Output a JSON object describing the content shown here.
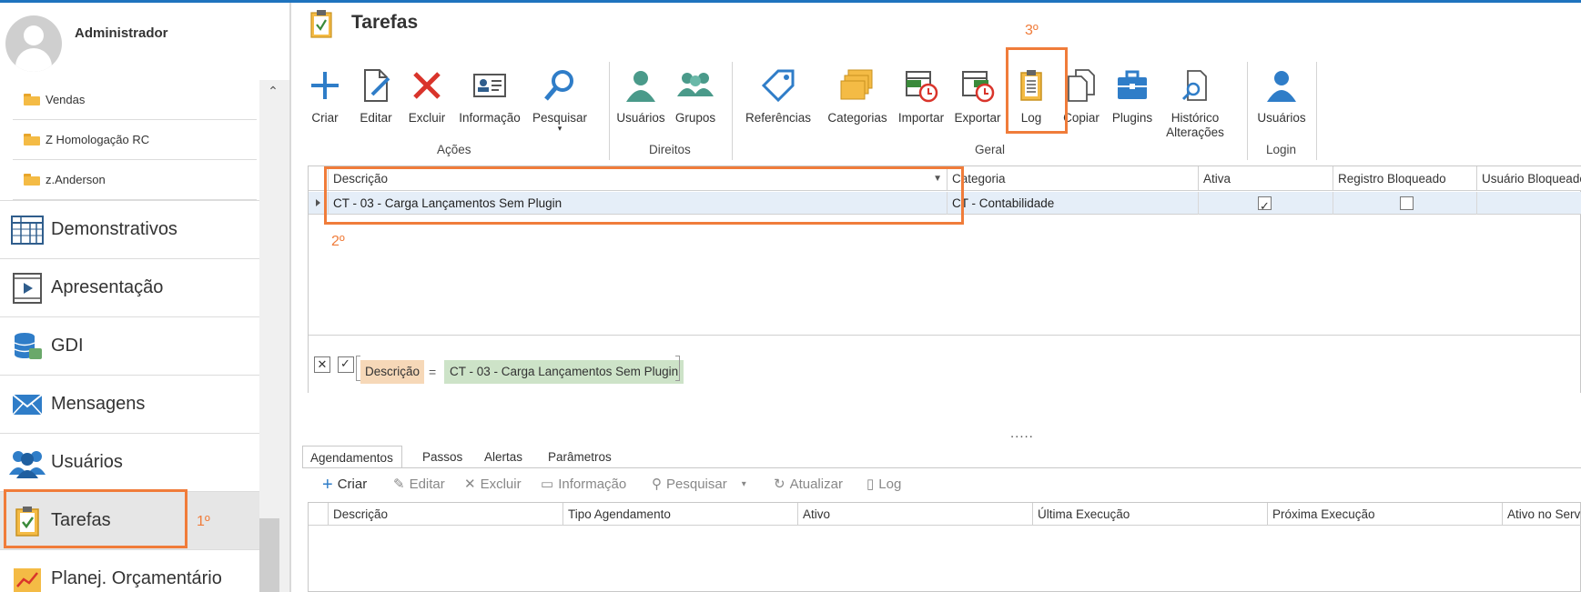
{
  "user": {
    "name": "Administrador"
  },
  "tree": {
    "items": [
      {
        "label": "Vendas"
      },
      {
        "label": "Z Homologação RC"
      },
      {
        "label": "z.Anderson"
      }
    ]
  },
  "nav": {
    "items": [
      {
        "label": "Demonstrativos",
        "icon": "table-chart-icon"
      },
      {
        "label": "Apresentação",
        "icon": "presentation-play-icon"
      },
      {
        "label": "GDI",
        "icon": "database-icon"
      },
      {
        "label": "Mensagens",
        "icon": "envelope-icon"
      },
      {
        "label": "Usuários",
        "icon": "users-icon"
      },
      {
        "label": "Tarefas",
        "icon": "clipboard-check-icon"
      },
      {
        "label": "Planej. Orçamentário",
        "icon": "trend-chart-icon"
      }
    ]
  },
  "page": {
    "title": "Tarefas"
  },
  "ribbon": {
    "acoes": {
      "label": "Ações",
      "buttons": [
        "Criar",
        "Editar",
        "Excluir",
        "Informação",
        "Pesquisar"
      ]
    },
    "direitos": {
      "label": "Direitos",
      "buttons": [
        "Usuários",
        "Grupos"
      ]
    },
    "geral": {
      "label": "Geral",
      "buttons": [
        "Referências",
        "Categorias",
        "Importar",
        "Exportar",
        "Log",
        "Copiar",
        "Plugins",
        "Histórico",
        "Alterações"
      ]
    },
    "login": {
      "label": "Login",
      "buttons": [
        "Usuários"
      ]
    }
  },
  "grid": {
    "columns": [
      "Descrição",
      "Categoria",
      "Ativa",
      "Registro Bloqueado",
      "Usuário Bloqueado"
    ],
    "rows": [
      {
        "descricao": "CT - 03 - Carga Lançamentos Sem Plugin",
        "categoria": "CT - Contabilidade",
        "ativa": true,
        "bloqueado": false
      }
    ]
  },
  "filter": {
    "field": "Descrição",
    "operator": "=",
    "value": "CT - 03 - Carga Lançamentos Sem Plugin"
  },
  "splitter": ".....",
  "tabs": [
    "Agendamentos",
    "Passos",
    "Alertas",
    "Parâmetros"
  ],
  "subtoolbar": [
    "Criar",
    "Editar",
    "Excluir",
    "Informação",
    "Pesquisar",
    "Atualizar",
    "Log"
  ],
  "grid2": {
    "columns": [
      "Descrição",
      "Tipo Agendamento",
      "Ativo",
      "Última Execução",
      "Próxima Execução",
      "Ativo no Servi"
    ]
  },
  "annotations": [
    "1º",
    "2º",
    "3º"
  ],
  "colors": {
    "accent": "#1e73be",
    "annotation": "#f07c3a",
    "selected_row": "#e5eef8"
  }
}
